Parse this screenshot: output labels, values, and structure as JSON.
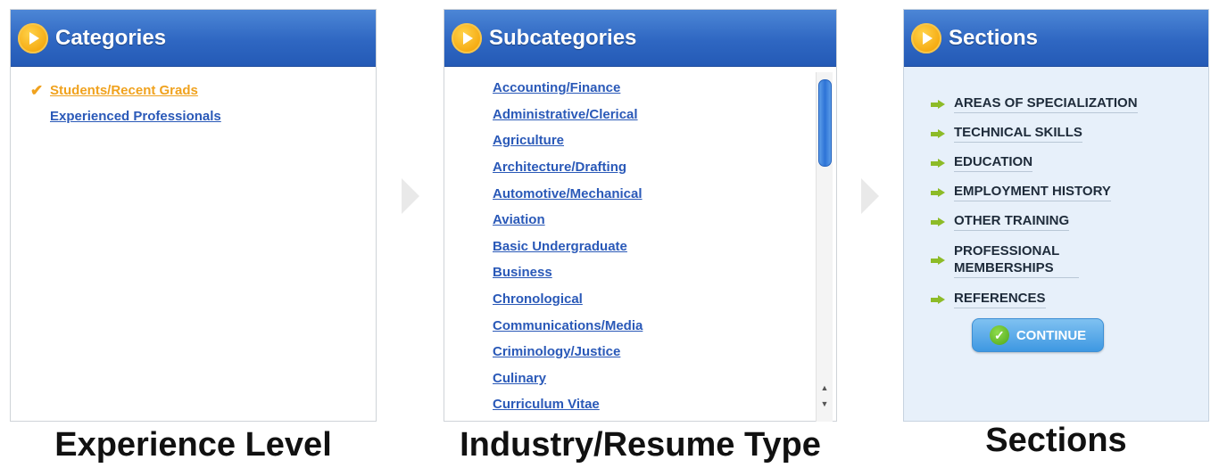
{
  "categories": {
    "title": "Categories",
    "items": [
      {
        "label": "Students/Recent Grads",
        "selected": true
      },
      {
        "label": "Experienced Professionals",
        "selected": false
      }
    ]
  },
  "subcategories": {
    "title": "Subcategories",
    "items": [
      "Accounting/Finance",
      "Administrative/Clerical",
      "Agriculture",
      "Architecture/Drafting",
      "Automotive/Mechanical",
      "Aviation",
      "Basic Undergraduate",
      "Business",
      "Chronological",
      "Communications/Media",
      "Criminology/Justice",
      "Culinary",
      "Curriculum Vitae"
    ]
  },
  "sections": {
    "title": "Sections",
    "items": [
      "AREAS OF SPECIALIZATION",
      "TECHNICAL SKILLS",
      "EDUCATION",
      "EMPLOYMENT HISTORY",
      "OTHER TRAINING",
      "PROFESSIONAL MEMBERSHIPS",
      "REFERENCES"
    ],
    "continue_label": "CONTINUE"
  },
  "captions": {
    "experience": "Experience Level",
    "industry": "Industry/Resume Type",
    "sections": "Sections"
  },
  "colors": {
    "header_blue": "#2f67c2",
    "link_blue": "#2a59b8",
    "selected_orange": "#f0a21e",
    "arrow_green": "#8dbb27",
    "sections_bg": "#e7f0fa"
  },
  "icons": {
    "header": "play-icon",
    "selected": "checkmark-icon",
    "section_bullet": "arrow-right-icon",
    "continue": "check-circle-icon"
  }
}
